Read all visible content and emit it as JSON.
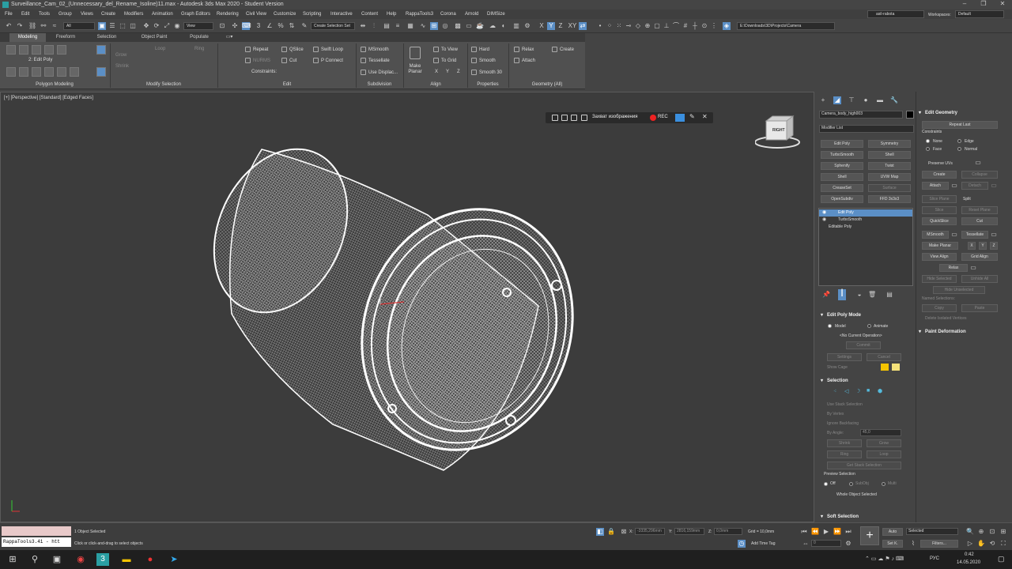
{
  "title": "Surveillance_Cam_02_(Unnecessary_del_Rename_Isoline)11.max - Autodesk 3ds Max 2020 - Student Version",
  "menu": [
    "File",
    "Edit",
    "Tools",
    "Group",
    "Views",
    "Create",
    "Modifiers",
    "Animation",
    "Graph Editors",
    "Rendering",
    "Civil View",
    "Customize",
    "Scripting",
    "Interactive",
    "Content",
    "Help",
    "RappaTools3",
    "Corona",
    "Arnold",
    "DIMSize"
  ],
  "user": "asil-rabota",
  "workspaces_label": "Workspaces:",
  "workspace": "Default",
  "toolbar": {
    "selection_filter": "All",
    "ref_coord": "View",
    "named_selection": "Create Selection Set",
    "path": "E:\\Downloads\\3D\\Projects\\Camera",
    "x": "X",
    "y": "Y",
    "z": "Z",
    "xy": "XY"
  },
  "ribbon_tabs": [
    "Modeling",
    "Freeform",
    "Selection",
    "Object Paint",
    "Populate"
  ],
  "ribbon": {
    "edit_poly_label": "2: Edit Poly",
    "grow": "Grow",
    "shrink": "Shrink",
    "loop": "Loop",
    "ring": "Ring",
    "repeat": "Repeat",
    "qslice": "QSlice",
    "swift_loop": "Swift Loop",
    "nurms": "NURMS",
    "cut": "Cut",
    "p_connect": "P Connect",
    "constraints": "Constraints:",
    "msmooth": "MSmooth",
    "tessellate": "Tessellate",
    "use_displace": "Use Displac...",
    "make_planar": "Make Planar",
    "to_view": "To View",
    "to_grid": "To Grid",
    "ax_x": "X",
    "ax_y": "Y",
    "ax_z": "Z",
    "hard": "Hard",
    "smooth": "Smooth",
    "smooth30": "Smooth 30",
    "relax": "Relax",
    "create": "Create",
    "attach": "Attach",
    "groups": [
      "Polygon Modeling",
      "Modify Selection",
      "Edit",
      "Subdivision",
      "Align",
      "Properties",
      "Geometry (All)"
    ]
  },
  "viewport": {
    "label": "[+] [Perspective] [Standard] [Edged Faces]",
    "capture_label": "Захват изображения",
    "rec": "REC",
    "cube_label": "RIGHT"
  },
  "cmd": {
    "object_name": "Camera_body_high003",
    "modifier_list": "Modifier List",
    "mod_buttons": [
      "Edit Poly",
      "Symmetry",
      "TurboSmooth",
      "Shell",
      "Sphenify",
      "Twist",
      "Shell",
      "UVW Map",
      "CreaseSet",
      "Surface",
      "OpenSubdiv",
      "FFD 3x3x3"
    ],
    "stack": [
      "Edit Poly",
      "TurboSmooth",
      "Editable Poly"
    ],
    "edit_poly_mode": "Edit Poly Mode",
    "model": "Model",
    "animate": "Animate",
    "no_op": "<No Current Operation>",
    "commit": "Commit",
    "settings": "Settings",
    "cancel": "Cancel",
    "show_cage": "Show Cage",
    "selection": "Selection",
    "use_stack": "Use Stack Selection",
    "by_vertex": "By Vertex",
    "ignore_backfacing": "Ignore Backfacing",
    "by_angle": "By Angle:",
    "angle_val": "45,0",
    "shrink": "Shrink",
    "grow": "Grow",
    "ring": "Ring",
    "loop": "Loop",
    "get_stack": "Get Stack Selection",
    "preview_sel": "Preview Selection",
    "off": "Off",
    "subobj": "SubObj",
    "multi": "Multi",
    "whole_sel": "Whole Object Selected",
    "soft_sel": "Soft Selection"
  },
  "geom": {
    "title": "Edit Geometry",
    "repeat_last": "Repeat Last",
    "constraints": "Constraints",
    "none": "None",
    "edge": "Edge",
    "face": "Face",
    "normal": "Normal",
    "preserve_uvs": "Preserve UVs",
    "create": "Create",
    "collapse": "Collapse",
    "attach": "Attach",
    "detach": "Detach",
    "slice_plane": "Slice Plane",
    "split": "Split",
    "slice": "Slice",
    "reset_plane": "Reset Plane",
    "quickslice": "QuickSlice",
    "cut": "Cut",
    "msmooth": "MSmooth",
    "tessellate": "Tessellate",
    "make_planar": "Make Planar",
    "x": "X",
    "y": "Y",
    "z": "Z",
    "view_align": "View Align",
    "grid_align": "Grid Align",
    "relax": "Relax",
    "hide_selected": "Hide Selected",
    "unhide_all": "Unhide All",
    "hide_unselected": "Hide Unselected",
    "named_selections": "Named Selections:",
    "copy": "Copy",
    "paste": "Paste",
    "delete_isolated": "Delete Isolated Vertices",
    "paint_deform": "Paint Deformation"
  },
  "status": {
    "script": "RappaTools3.41 - htt",
    "objects": "1 Object Selected",
    "hint": "Click or click-and-drag to select objects",
    "x_label": "X:",
    "x_val": "-3335,296mm",
    "y_label": "Y:",
    "y_val": "2816,159mm",
    "z_label": "Z:",
    "z_val": "0,0mm",
    "grid": "Grid = 10,0mm",
    "add_time_tag": "Add Time Tag",
    "auto": "Auto",
    "setk": "Set K.",
    "selected": "Selected",
    "filters": "Filters...",
    "frame": "0"
  },
  "taskbar": {
    "lang": "РУС",
    "time": "0:42",
    "date": "14.05.2020"
  }
}
